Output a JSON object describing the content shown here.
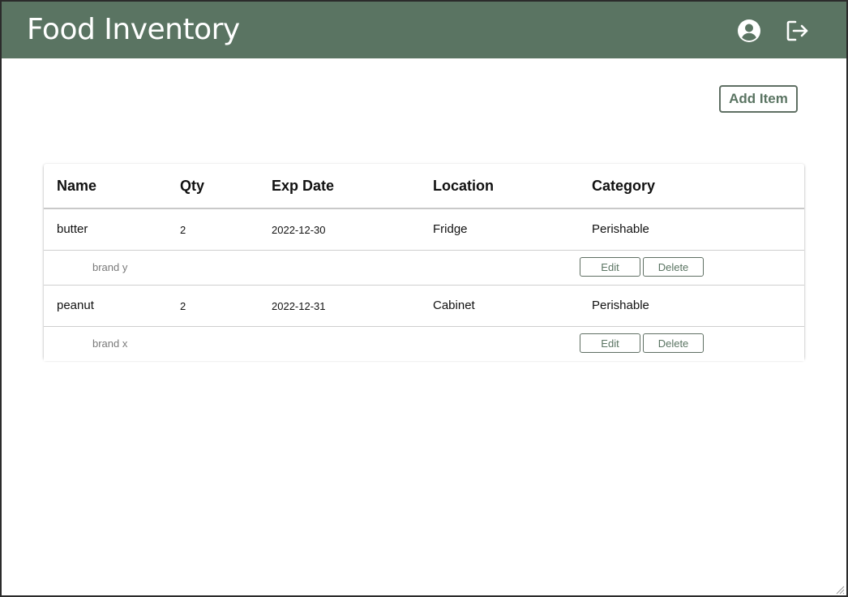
{
  "app": {
    "title": "Food Inventory"
  },
  "header": {
    "profile_icon": "account-circle-icon",
    "logout_icon": "logout-icon"
  },
  "toolbar": {
    "add_item_label": "Add Item"
  },
  "table": {
    "columns": [
      "Name",
      "Qty",
      "Exp Date",
      "Location",
      "Category"
    ],
    "rows": [
      {
        "name": "butter",
        "qty": "2",
        "exp_date": "2022-12-30",
        "location": "Fridge",
        "category": "Perishable",
        "brand": "brand y",
        "edit_label": "Edit",
        "delete_label": "Delete"
      },
      {
        "name": "peanut",
        "qty": "2",
        "exp_date": "2022-12-31",
        "location": "Cabinet",
        "category": "Perishable",
        "brand": "brand x",
        "edit_label": "Edit",
        "delete_label": "Delete"
      }
    ]
  },
  "colors": {
    "header_bg": "#5a7462",
    "accent": "#5a7462",
    "text": "#111111",
    "muted_text": "#7a7a7a"
  }
}
